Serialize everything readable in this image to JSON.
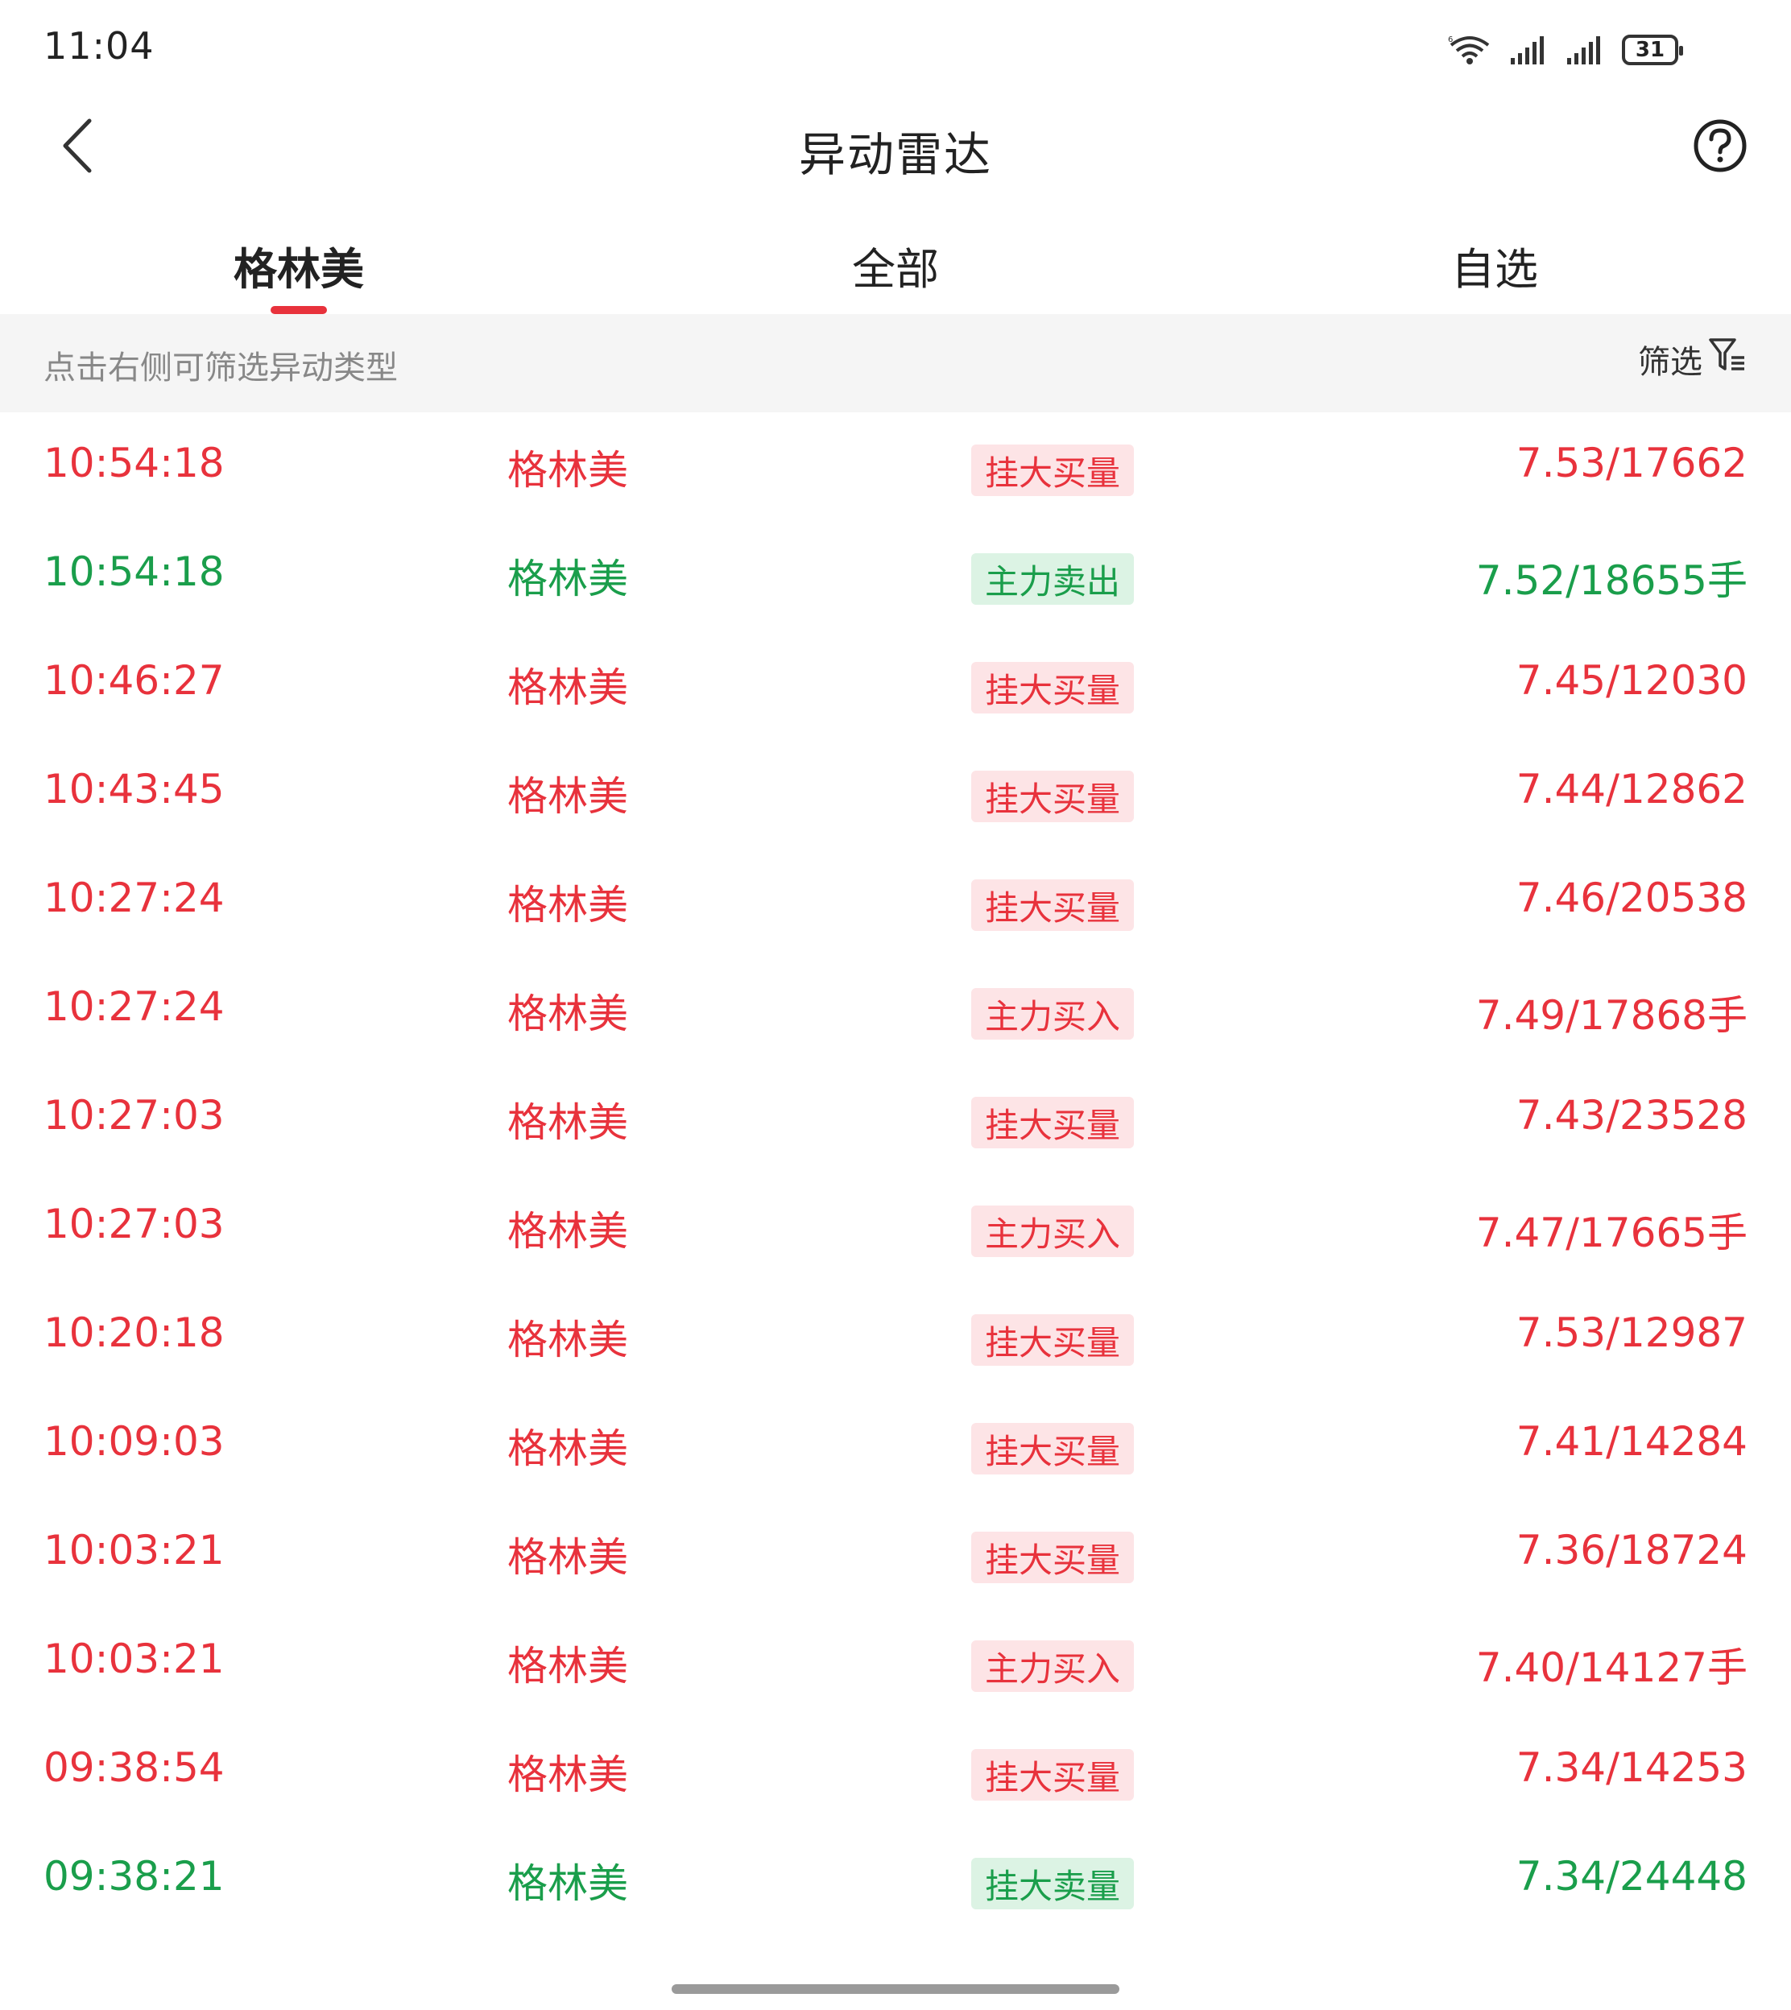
{
  "status_bar": {
    "time": "11:04",
    "battery": "31"
  },
  "header": {
    "title": "异动雷达"
  },
  "tabs": [
    {
      "label": "格林美"
    },
    {
      "label": "全部"
    },
    {
      "label": "自选"
    }
  ],
  "filter": {
    "hint": "点击右侧可筛选异动类型",
    "button_label": "筛选"
  },
  "colors": {
    "up": "#e8323c",
    "down": "#1a9e4b",
    "up_badge_bg": "#fde4e6",
    "down_badge_bg": "#dcf3e4"
  },
  "rows": [
    {
      "time": "10:54:18",
      "name": "格林美",
      "type": "挂大买量",
      "value": "7.53/17662",
      "color": "red"
    },
    {
      "time": "10:54:18",
      "name": "格林美",
      "type": "主力卖出",
      "value": "7.52/18655手",
      "color": "green"
    },
    {
      "time": "10:46:27",
      "name": "格林美",
      "type": "挂大买量",
      "value": "7.45/12030",
      "color": "red"
    },
    {
      "time": "10:43:45",
      "name": "格林美",
      "type": "挂大买量",
      "value": "7.44/12862",
      "color": "red"
    },
    {
      "time": "10:27:24",
      "name": "格林美",
      "type": "挂大买量",
      "value": "7.46/20538",
      "color": "red"
    },
    {
      "time": "10:27:24",
      "name": "格林美",
      "type": "主力买入",
      "value": "7.49/17868手",
      "color": "red"
    },
    {
      "time": "10:27:03",
      "name": "格林美",
      "type": "挂大买量",
      "value": "7.43/23528",
      "color": "red"
    },
    {
      "time": "10:27:03",
      "name": "格林美",
      "type": "主力买入",
      "value": "7.47/17665手",
      "color": "red"
    },
    {
      "time": "10:20:18",
      "name": "格林美",
      "type": "挂大买量",
      "value": "7.53/12987",
      "color": "red"
    },
    {
      "time": "10:09:03",
      "name": "格林美",
      "type": "挂大买量",
      "value": "7.41/14284",
      "color": "red"
    },
    {
      "time": "10:03:21",
      "name": "格林美",
      "type": "挂大买量",
      "value": "7.36/18724",
      "color": "red"
    },
    {
      "time": "10:03:21",
      "name": "格林美",
      "type": "主力买入",
      "value": "7.40/14127手",
      "color": "red"
    },
    {
      "time": "09:38:54",
      "name": "格林美",
      "type": "挂大买量",
      "value": "7.34/14253",
      "color": "red"
    },
    {
      "time": "09:38:21",
      "name": "格林美",
      "type": "挂大卖量",
      "value": "7.34/24448",
      "color": "green"
    }
  ]
}
